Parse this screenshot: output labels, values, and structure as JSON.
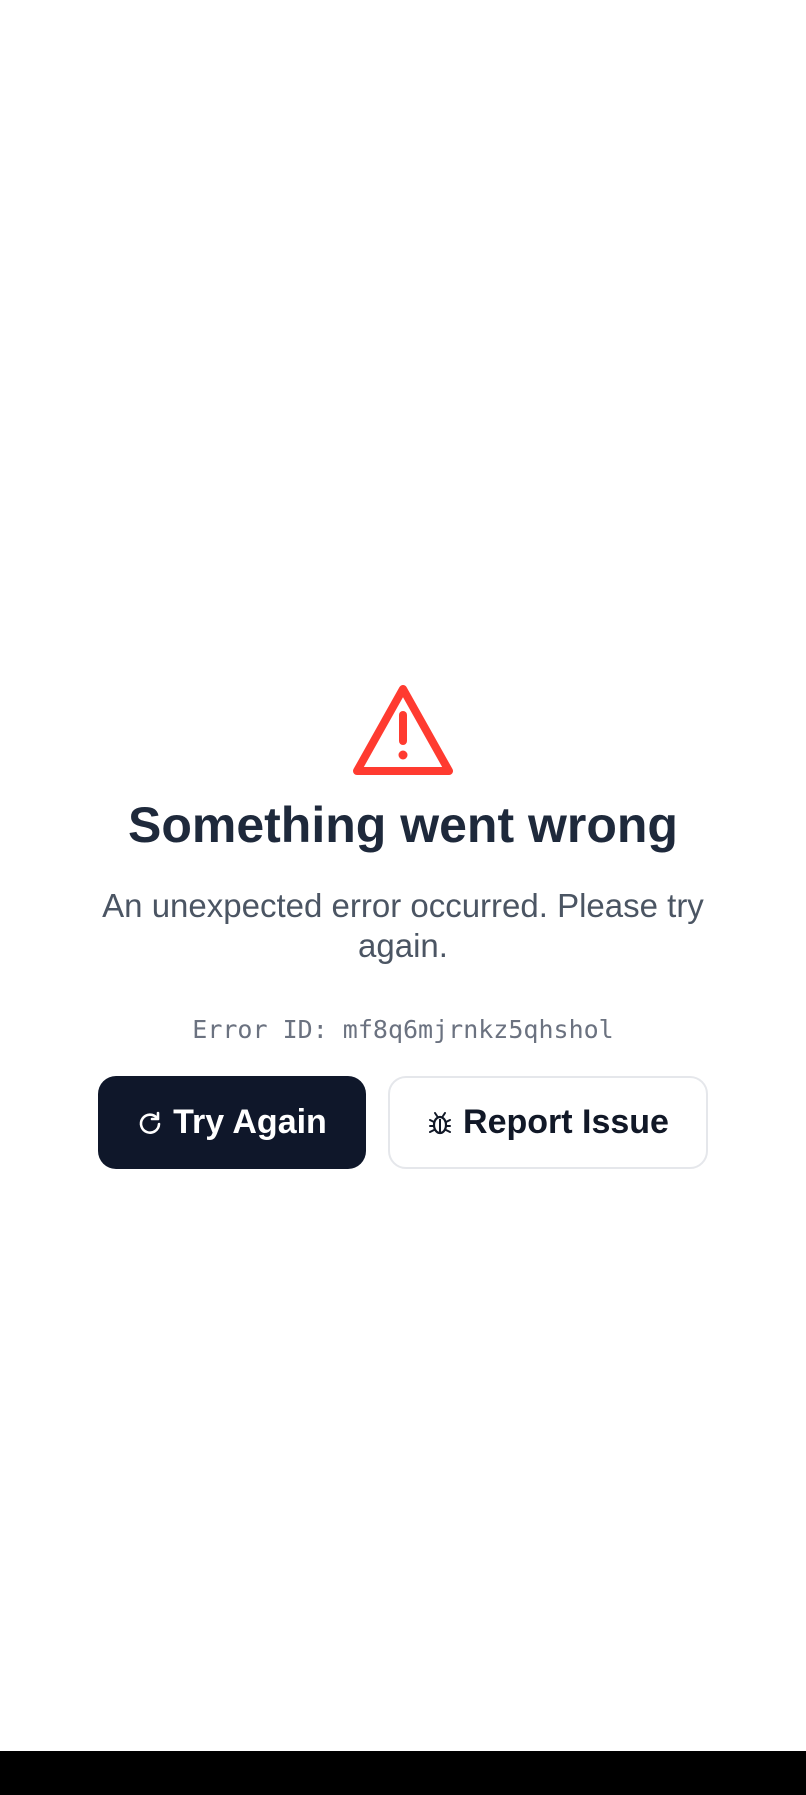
{
  "error_page": {
    "title": "Something went wrong",
    "message": "An unexpected error occurred. Please try again.",
    "error_id": "Error ID: mf8q6mjrnkz5qhshol",
    "icons": {
      "status": "warning-triangle-icon",
      "retry": "refresh-icon",
      "report": "bug-icon"
    },
    "colors": {
      "warning": "#ff3b30",
      "title": "#1e293b",
      "message": "#4b5563",
      "primary_button": "#0f172a"
    }
  },
  "actions": {
    "try_again_label": "Try Again",
    "report_issue_label": "Report Issue"
  }
}
